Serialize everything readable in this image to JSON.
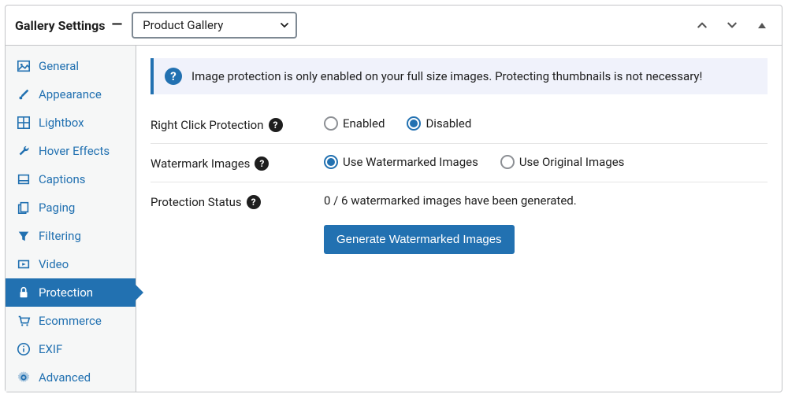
{
  "header": {
    "title": "Gallery Settings",
    "select_value": "Product Gallery"
  },
  "sidebar": {
    "items": [
      {
        "label": "General"
      },
      {
        "label": "Appearance"
      },
      {
        "label": "Lightbox"
      },
      {
        "label": "Hover Effects"
      },
      {
        "label": "Captions"
      },
      {
        "label": "Paging"
      },
      {
        "label": "Filtering"
      },
      {
        "label": "Video"
      },
      {
        "label": "Protection"
      },
      {
        "label": "Ecommerce"
      },
      {
        "label": "EXIF"
      },
      {
        "label": "Advanced"
      }
    ],
    "active_index": 8
  },
  "content": {
    "notice": "Image protection is only enabled on your full size images. Protecting thumbnails is not necessary!",
    "rows": {
      "right_click": {
        "label": "Right Click Protection",
        "options": {
          "enabled": "Enabled",
          "disabled": "Disabled"
        },
        "selected": "disabled"
      },
      "watermark": {
        "label": "Watermark Images",
        "options": {
          "watermarked": "Use Watermarked Images",
          "original": "Use Original Images"
        },
        "selected": "watermarked"
      },
      "status": {
        "label": "Protection Status",
        "text": "0 / 6 watermarked images have been generated.",
        "button": "Generate Watermarked Images"
      }
    }
  }
}
